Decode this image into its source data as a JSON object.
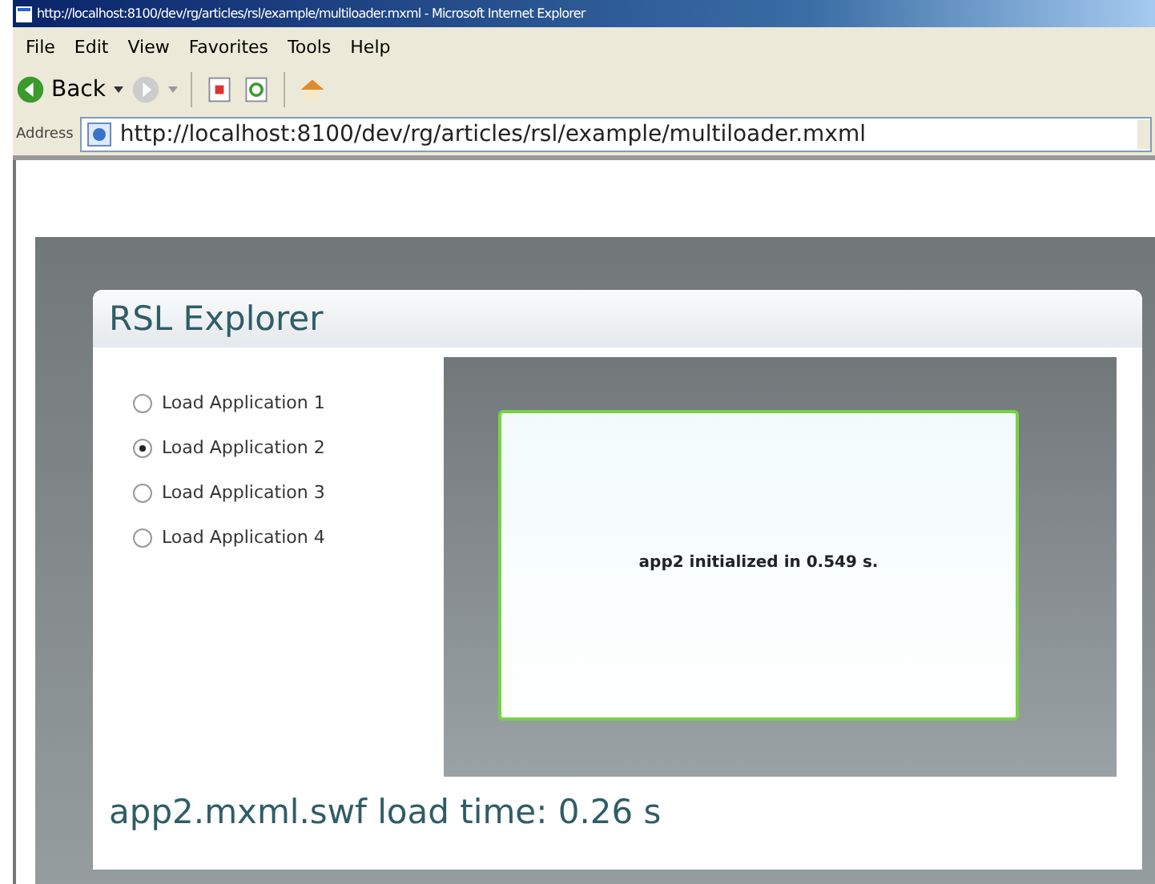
{
  "window": {
    "title": "http://localhost:8100/dev/rg/articles/rsl/example/multiloader.mxml - Microsoft Internet Explorer"
  },
  "menu": [
    "File",
    "Edit",
    "View",
    "Favorites",
    "Tools",
    "Help"
  ],
  "toolbar": {
    "back_label": "Back"
  },
  "address": {
    "label": "Address",
    "url": "http://localhost:8100/dev/rg/articles/rsl/example/multiloader.mxml"
  },
  "app": {
    "title": "RSL Explorer",
    "options": [
      {
        "label": "Load Application 1",
        "selected": false
      },
      {
        "label": "Load Application 2",
        "selected": true
      },
      {
        "label": "Load Application 3",
        "selected": false
      },
      {
        "label": "Load Application 4",
        "selected": false
      }
    ],
    "message": "app2 initialized in 0.549 s.",
    "status": "app2.mxml.swf load time: 0.26 s"
  }
}
